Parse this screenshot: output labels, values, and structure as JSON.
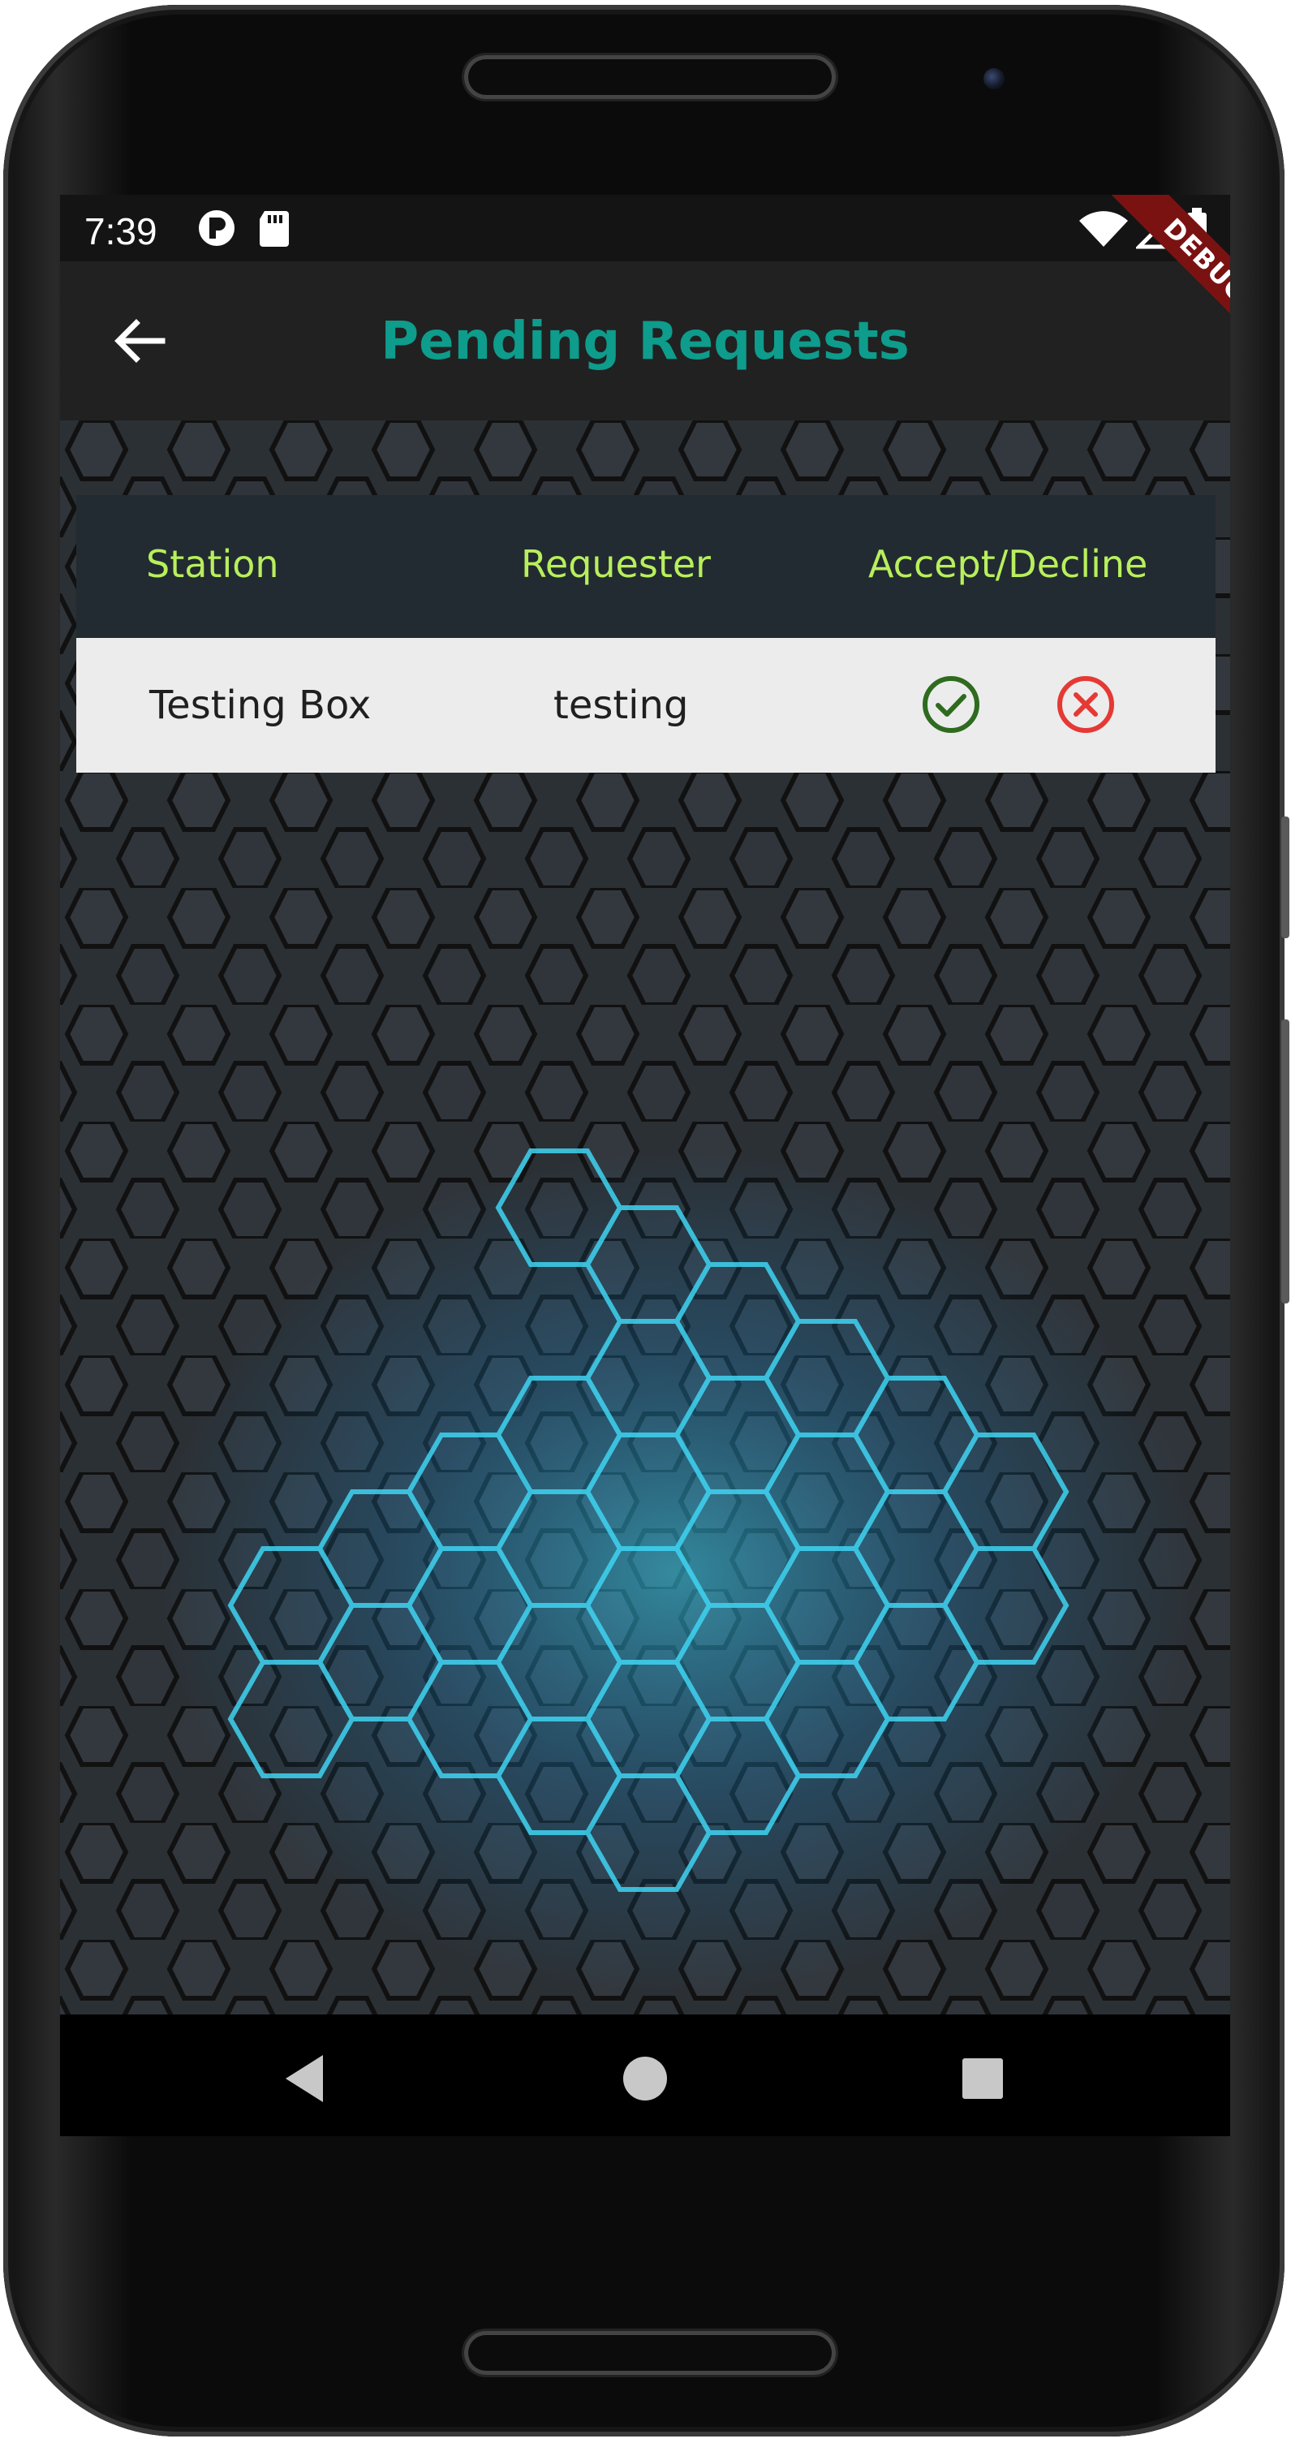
{
  "status_bar": {
    "time": "7:39"
  },
  "app_bar": {
    "title": "Pending Requests",
    "debug_label": "DEBUG"
  },
  "table": {
    "headers": [
      "Station",
      "Requester",
      "Accept/Decline"
    ],
    "rows": [
      {
        "station": "Testing Box",
        "requester": "testing"
      }
    ]
  },
  "colors": {
    "title": "#0e9c8c",
    "header_text": "#b8ef5c",
    "header_bg": "#222b31",
    "row_bg": "#ececec",
    "accept": "#2e6b1f",
    "decline": "#e53935",
    "glow": "#3ad0f0"
  },
  "icons": {
    "back": "arrow-left-icon",
    "accept": "check-circle-icon",
    "decline": "cancel-circle-icon",
    "nav": [
      "triangle-back-icon",
      "circle-home-icon",
      "square-recents-icon"
    ]
  }
}
